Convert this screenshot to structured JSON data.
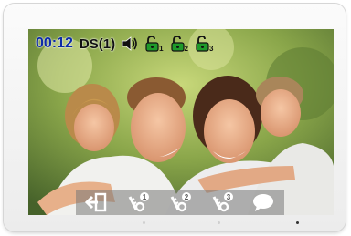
{
  "status_bar": {
    "time": "00:12",
    "source": "DS(1)",
    "speaker_icon": "speaker-icon",
    "locks": [
      {
        "icon": "unlock-icon",
        "sub": "1"
      },
      {
        "icon": "unlock-icon",
        "sub": "2"
      },
      {
        "icon": "unlock-icon",
        "sub": "3"
      }
    ]
  },
  "toolbar": {
    "buttons": [
      {
        "icon": "exit-icon"
      },
      {
        "icon": "key-icon",
        "badge": "1"
      },
      {
        "icon": "key-icon",
        "badge": "2"
      },
      {
        "icon": "key-icon",
        "badge": "3"
      },
      {
        "icon": "chat-icon"
      }
    ]
  },
  "colors": {
    "time_text": "#0c2aa8",
    "lock_green": "#1f9a2a",
    "toolbar_bg": "#787878"
  }
}
